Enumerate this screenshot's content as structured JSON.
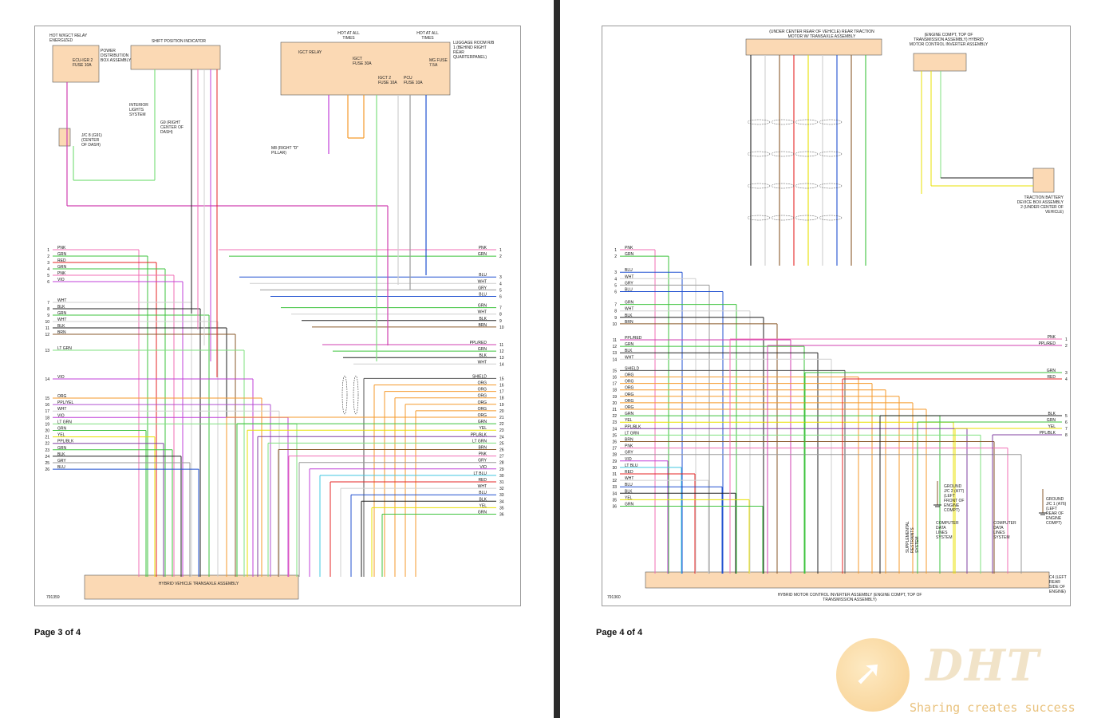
{
  "pages": [
    {
      "page_label": "Page 3 of 4",
      "figure_id": "791359",
      "blocks": {
        "relay_note": "HOT W/IGCT RELAY ENERGIZED",
        "fuse": "ECU-IGR 2 FUSE 10A",
        "pdb": "POWER DISTRIBUTION BOX ASSEMBLY",
        "shift": "SHIFT POSITION INDICATOR",
        "interior": "INTERIOR LIGHTS SYSTEM",
        "g9": "G9 (RIGHT CENTER OF DASH)",
        "jc": "J/C 8 (G91) (CENTER OF DASH)",
        "hot1": "HOT AT ALL TIMES",
        "hot2": "HOT AT ALL TIMES",
        "igct_relay": "IGCT RELAY",
        "igct_fuse": "IGCT FUSE 30A",
        "igct2": "IGCT 2 FUSE 10A",
        "pcu": "PCU FUSE 10A",
        "mg": "MG FUSE 7.5A",
        "rb": "LUGGAGE ROOM R/B 1 (BEHIND RIGHT REAR QUARTERPANEL)",
        "m8": "M8 (RIGHT \"D\" PILLAR)",
        "bottom": "HYBRID VEHICLE TRANSAXLE ASSEMBLY"
      },
      "left_wires": [
        {
          "n": "1",
          "label": "PNK",
          "color": "#f06fb4"
        },
        {
          "n": "2",
          "label": "GRN",
          "color": "#3ec33e"
        },
        {
          "n": "3",
          "label": "RED",
          "color": "#e52525"
        },
        {
          "n": "4",
          "label": "GRN",
          "color": "#3ec33e"
        },
        {
          "n": "5",
          "label": "PNK",
          "color": "#f06fb4"
        },
        {
          "n": "6",
          "label": "VIO",
          "color": "#c040d8"
        },
        {
          "n": "7",
          "label": "WHT",
          "color": "#cfcfcf"
        },
        {
          "n": "8",
          "label": "BLK",
          "color": "#222222"
        },
        {
          "n": "9",
          "label": "GRN",
          "color": "#3ec33e"
        },
        {
          "n": "10",
          "label": "WHT",
          "color": "#cfcfcf"
        },
        {
          "n": "11",
          "label": "BLK",
          "color": "#222222"
        },
        {
          "n": "12",
          "label": "BRN",
          "color": "#8a5a2b"
        },
        {
          "n": "13",
          "label": "LT GRN",
          "color": "#7fe07f"
        },
        {
          "n": "14",
          "label": "VIO",
          "color": "#c040d8"
        },
        {
          "n": "15",
          "label": "ORG",
          "color": "#f59a2b"
        },
        {
          "n": "16",
          "label": "PPL/YEL",
          "color": "#b050d0"
        },
        {
          "n": "17",
          "label": "WHT",
          "color": "#cfcfcf"
        },
        {
          "n": "18",
          "label": "VIO",
          "color": "#c040d8"
        },
        {
          "n": "19",
          "label": "LT GRN",
          "color": "#7fe07f"
        },
        {
          "n": "20",
          "label": "GRN",
          "color": "#3ec33e"
        },
        {
          "n": "21",
          "label": "YEL",
          "color": "#e8e000"
        },
        {
          "n": "22",
          "label": "PPL/BLK",
          "color": "#8040a0"
        },
        {
          "n": "23",
          "label": "GRN",
          "color": "#3ec33e"
        },
        {
          "n": "24",
          "label": "BLK",
          "color": "#222222"
        },
        {
          "n": "25",
          "label": "GRY",
          "color": "#9a9a9a"
        },
        {
          "n": "26",
          "label": "BLU",
          "color": "#2050d0"
        }
      ],
      "right_wires": [
        {
          "n": "1",
          "label": "PNK",
          "color": "#f06fb4"
        },
        {
          "n": "2",
          "label": "GRN",
          "color": "#3ec33e"
        },
        {
          "n": "3",
          "label": "BLU",
          "color": "#2050d0"
        },
        {
          "n": "4",
          "label": "WHT",
          "color": "#cfcfcf"
        },
        {
          "n": "5",
          "label": "GRY",
          "color": "#9a9a9a"
        },
        {
          "n": "6",
          "label": "BLU",
          "color": "#2050d0"
        },
        {
          "n": "7",
          "label": "GRN",
          "color": "#3ec33e"
        },
        {
          "n": "8",
          "label": "WHT",
          "color": "#cfcfcf"
        },
        {
          "n": "9",
          "label": "BLK",
          "color": "#222222"
        },
        {
          "n": "10",
          "label": "BRN",
          "color": "#8a5a2b"
        },
        {
          "n": "11",
          "label": "PPL/RED",
          "color": "#d040b0"
        },
        {
          "n": "12",
          "label": "GRN",
          "color": "#3ec33e"
        },
        {
          "n": "13",
          "label": "BLK",
          "color": "#222222"
        },
        {
          "n": "14",
          "label": "WHT",
          "color": "#cfcfcf"
        },
        {
          "n": "15",
          "label": "SHIELD",
          "color": "#555555"
        },
        {
          "n": "16",
          "label": "ORG",
          "color": "#f59a2b"
        },
        {
          "n": "17",
          "label": "ORG",
          "color": "#f59a2b"
        },
        {
          "n": "18",
          "label": "ORG",
          "color": "#f59a2b"
        },
        {
          "n": "19",
          "label": "ORG",
          "color": "#f59a2b"
        },
        {
          "n": "20",
          "label": "ORG",
          "color": "#f59a2b"
        },
        {
          "n": "21",
          "label": "ORG",
          "color": "#f59a2b"
        },
        {
          "n": "22",
          "label": "GRN",
          "color": "#3ec33e"
        },
        {
          "n": "23",
          "label": "YEL",
          "color": "#e8e000"
        },
        {
          "n": "24",
          "label": "PPL/BLK",
          "color": "#8040a0"
        },
        {
          "n": "25",
          "label": "LT GRN",
          "color": "#7fe07f"
        },
        {
          "n": "26",
          "label": "BRN",
          "color": "#8a5a2b"
        },
        {
          "n": "27",
          "label": "PNK",
          "color": "#f06fb4"
        },
        {
          "n": "28",
          "label": "GRY",
          "color": "#9a9a9a"
        },
        {
          "n": "29",
          "label": "VIO",
          "color": "#c040d8"
        },
        {
          "n": "30",
          "label": "LT BLU",
          "color": "#40c8e0"
        },
        {
          "n": "31",
          "label": "RED",
          "color": "#e52525"
        },
        {
          "n": "32",
          "label": "WHT",
          "color": "#cfcfcf"
        },
        {
          "n": "33",
          "label": "BLU",
          "color": "#2050d0"
        },
        {
          "n": "34",
          "label": "BLK",
          "color": "#222222"
        },
        {
          "n": "35",
          "label": "YEL",
          "color": "#e8e000"
        },
        {
          "n": "36",
          "label": "GRN",
          "color": "#3ec33e"
        }
      ]
    },
    {
      "page_label": "Page 4 of 4",
      "figure_id": "791360",
      "blocks": {
        "motor": "(UNDER CENTER REAR OF VEHICLE) REAR TRACTION MOTOR W/ TRANSAXLE ASSEMBLY",
        "inverter_top": "(ENGINE COMPT, TOP OF TRANSMISSION ASSEMBLY) HYBRID MOTOR CONTROL INVERTER ASSEMBLY",
        "battery": "TRACTION BATTERY DEVICE BOX ASSEMBLY 2 (UNDER CENTER OF VEHICLE)",
        "ground1": "GROUND J/C 2 (A77) (LEFT FRONT OF ENGINE COMPT)",
        "ground2": "GROUND J/C 1 (A76) (LEFT REAR OF ENGINE COMPT)",
        "c4": "C4 (LEFT REAR SIDE OF ENGINE)",
        "supp": "SUPPLEMENTAL RESTRAINTS SYSTEM",
        "comp1": "COMPUTER DATA LINES SYSTEM",
        "comp2": "COMPUTER DATA LINES SYSTEM",
        "bottom": "HYBRID MOTOR CONTROL INVERTER ASSEMBLY (ENGINE COMPT, TOP OF TRANSMISSION ASSEMBLY)"
      },
      "left_wires": [
        {
          "n": "1",
          "label": "PNK",
          "color": "#f06fb4"
        },
        {
          "n": "2",
          "label": "GRN",
          "color": "#3ec33e"
        },
        {
          "n": "3",
          "label": "BLU",
          "color": "#2050d0"
        },
        {
          "n": "4",
          "label": "WHT",
          "color": "#cfcfcf"
        },
        {
          "n": "5",
          "label": "GRY",
          "color": "#9a9a9a"
        },
        {
          "n": "6",
          "label": "BLU",
          "color": "#2050d0"
        },
        {
          "n": "7",
          "label": "GRN",
          "color": "#3ec33e"
        },
        {
          "n": "8",
          "label": "WHT",
          "color": "#cfcfcf"
        },
        {
          "n": "9",
          "label": "BLK",
          "color": "#222222"
        },
        {
          "n": "10",
          "label": "BRN",
          "color": "#8a5a2b"
        },
        {
          "n": "11",
          "label": "PPL/RED",
          "color": "#d040b0"
        },
        {
          "n": "12",
          "label": "GRN",
          "color": "#3ec33e"
        },
        {
          "n": "13",
          "label": "BLK",
          "color": "#222222"
        },
        {
          "n": "14",
          "label": "WHT",
          "color": "#cfcfcf"
        },
        {
          "n": "15",
          "label": "SHIELD",
          "color": "#555555"
        },
        {
          "n": "16",
          "label": "ORG",
          "color": "#f59a2b"
        },
        {
          "n": "17",
          "label": "ORG",
          "color": "#f59a2b"
        },
        {
          "n": "18",
          "label": "ORG",
          "color": "#f59a2b"
        },
        {
          "n": "19",
          "label": "ORG",
          "color": "#f59a2b"
        },
        {
          "n": "20",
          "label": "ORG",
          "color": "#f59a2b"
        },
        {
          "n": "21",
          "label": "ORG",
          "color": "#f59a2b"
        },
        {
          "n": "22",
          "label": "GRN",
          "color": "#3ec33e"
        },
        {
          "n": "23",
          "label": "YEL",
          "color": "#e8e000"
        },
        {
          "n": "24",
          "label": "PPL/BLK",
          "color": "#8040a0"
        },
        {
          "n": "25",
          "label": "LT GRN",
          "color": "#7fe07f"
        },
        {
          "n": "26",
          "label": "BRN",
          "color": "#8a5a2b"
        },
        {
          "n": "27",
          "label": "PNK",
          "color": "#f06fb4"
        },
        {
          "n": "28",
          "label": "GRY",
          "color": "#9a9a9a"
        },
        {
          "n": "29",
          "label": "VIO",
          "color": "#c040d8"
        },
        {
          "n": "30",
          "label": "LT BLU",
          "color": "#40c8e0"
        },
        {
          "n": "31",
          "label": "RED",
          "color": "#e52525"
        },
        {
          "n": "32",
          "label": "WHT",
          "color": "#cfcfcf"
        },
        {
          "n": "33",
          "label": "BLU",
          "color": "#2050d0"
        },
        {
          "n": "34",
          "label": "BLK",
          "color": "#222222"
        },
        {
          "n": "35",
          "label": "YEL",
          "color": "#e8e000"
        },
        {
          "n": "36",
          "label": "GRN",
          "color": "#3ec33e"
        }
      ],
      "right_wires": [
        {
          "n": "1",
          "label": "PNK",
          "color": "#f06fb4"
        },
        {
          "n": "2",
          "label": "PPL/RED",
          "color": "#d040b0"
        },
        {
          "n": "3",
          "label": "GRN",
          "color": "#3ec33e"
        },
        {
          "n": "4",
          "label": "RED",
          "color": "#e52525"
        },
        {
          "n": "5",
          "label": "BLK",
          "color": "#222222"
        },
        {
          "n": "6",
          "label": "GRN",
          "color": "#3ec33e"
        },
        {
          "n": "7",
          "label": "YEL",
          "color": "#e8e000"
        },
        {
          "n": "8",
          "label": "PPL/BLK",
          "color": "#8040a0"
        }
      ]
    }
  ],
  "watermark": {
    "logo": "DHT",
    "tagline": "Sharing creates success"
  }
}
